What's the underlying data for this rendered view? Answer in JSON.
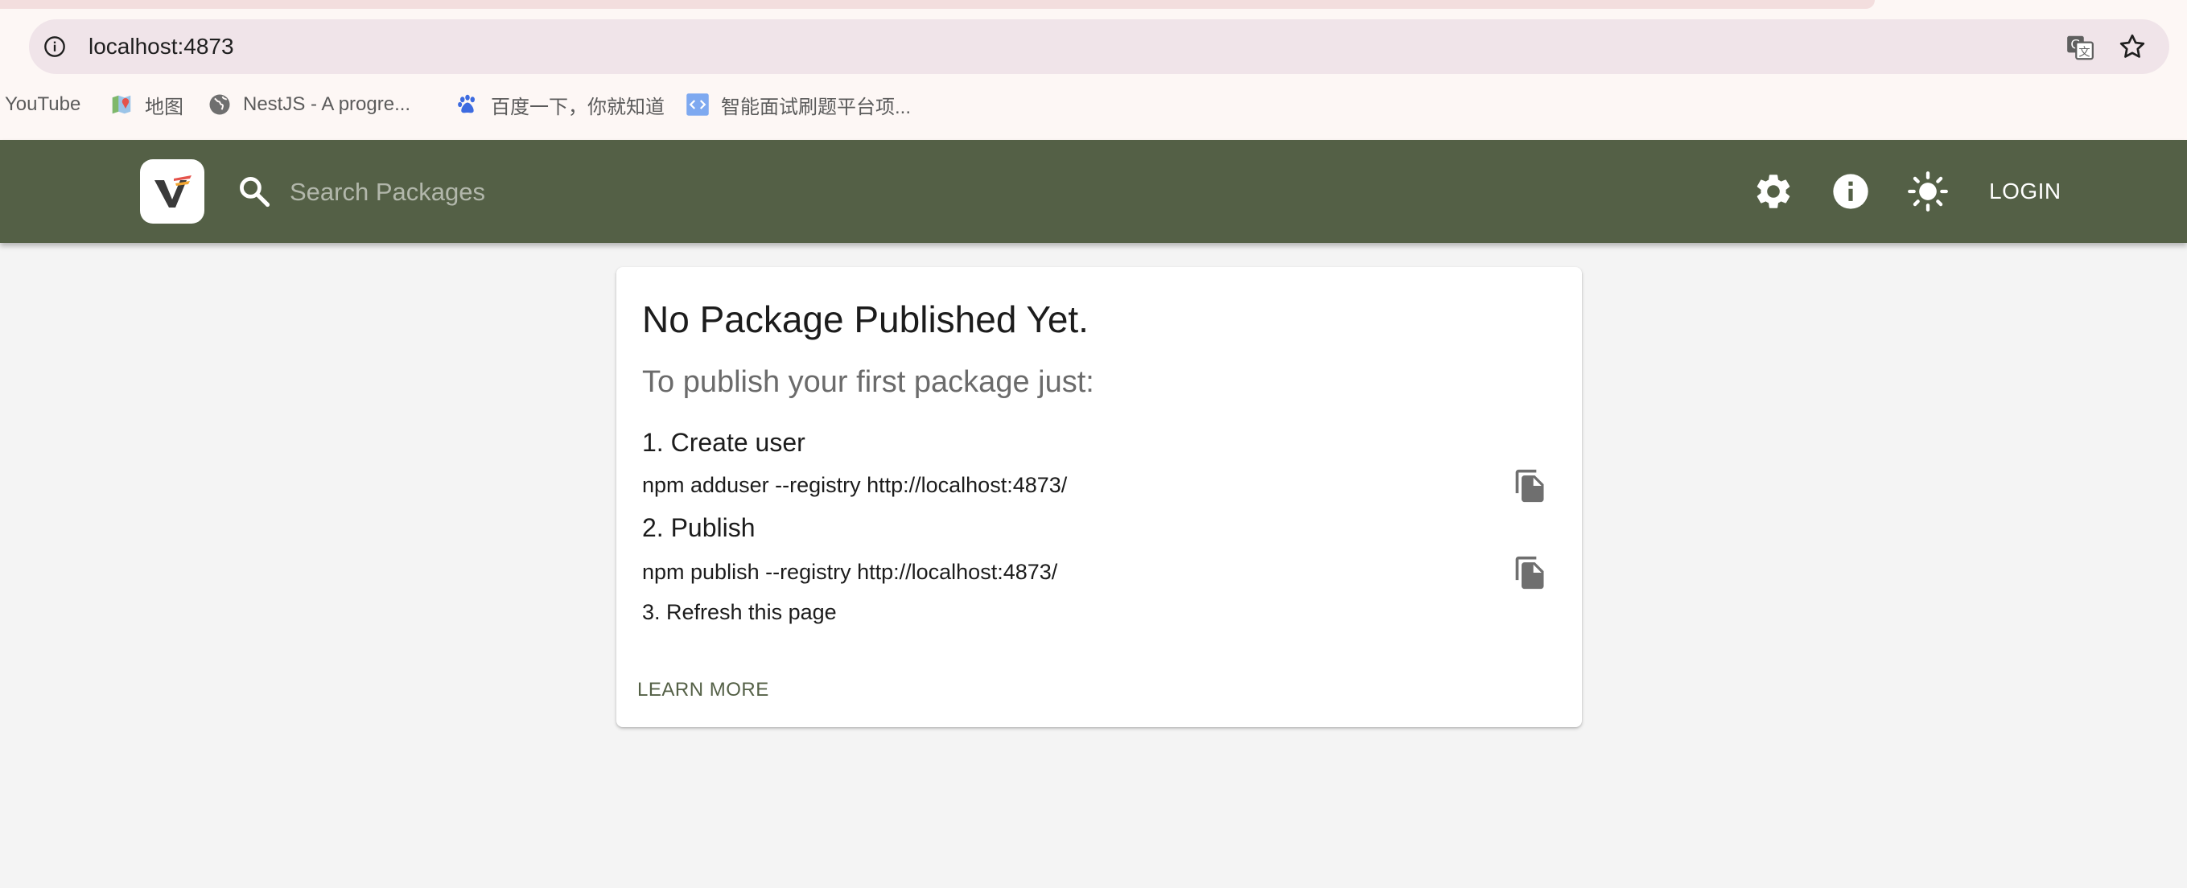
{
  "browser": {
    "url": "localhost:4873",
    "bookmarks": [
      {
        "label": "YouTube",
        "icon": "none"
      },
      {
        "label": "地图",
        "icon": "maps-icon"
      },
      {
        "label": "NestJS - A progre...",
        "icon": "globe-icon"
      },
      {
        "label": "百度一下，你就知道",
        "icon": "baidu-paw-icon"
      },
      {
        "label": "智能面试刷题平台项...",
        "icon": "code-icon"
      }
    ]
  },
  "header": {
    "search_placeholder": "Search Packages",
    "login_label": "LOGIN",
    "bar_color": "#546046",
    "icons": [
      "settings-gear-icon",
      "info-icon",
      "light-theme-icon"
    ]
  },
  "card": {
    "title": "No Package Published Yet.",
    "subtitle": "To publish your first package just:",
    "step1_title": "1. Create user",
    "step1_command": "npm adduser --registry http://localhost:4873/",
    "step2_title": "2. Publish",
    "step2_command": "npm publish --registry http://localhost:4873/",
    "step3": "3. Refresh this page",
    "learn_more": "LEARN MORE"
  }
}
